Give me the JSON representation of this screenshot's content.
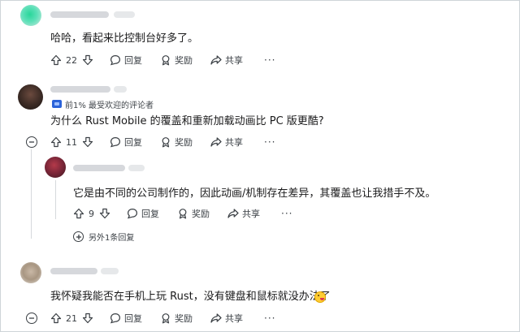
{
  "comments": [
    {
      "body": "哈哈，看起来比控制台好多了。",
      "actions": {
        "score": "22",
        "reply": "回复",
        "award": "奖励",
        "share": "共享",
        "more": "···"
      }
    },
    {
      "badge": "前1% 最受欢迎的评论者",
      "body": "为什么 Rust Mobile 的覆盖和重新加载动画比 PC 版更酷?",
      "actions": {
        "score": "11",
        "reply": "回复",
        "award": "奖励",
        "share": "共享",
        "more": "···"
      },
      "reply": {
        "body": "它是由不同的公司制作的，因此动画/机制存在差异，其覆盖也让我措手不及。",
        "actions": {
          "score": "9",
          "reply": "回复",
          "award": "奖励",
          "share": "共享",
          "more": "···"
        },
        "more_replies": "另外1条回复"
      }
    },
    {
      "body": "我怀疑我能否在手机上玩 Rust，没有键盘和鼠标就没办法了",
      "emoji": "smiling-face-with-tongue",
      "actions": {
        "score": "21",
        "reply": "回复",
        "award": "奖励",
        "share": "共享",
        "more": "···"
      }
    }
  ],
  "colors": {
    "text": "#1a1a1b",
    "muted": "#3a3f44",
    "badge": "#2b63d9",
    "thread_line": "#d6d9dc"
  }
}
